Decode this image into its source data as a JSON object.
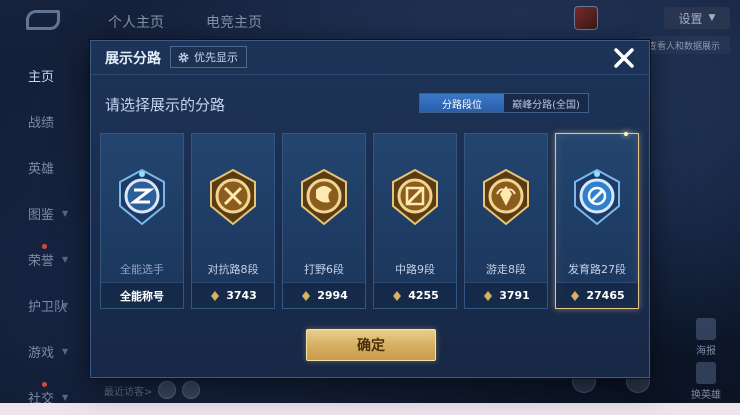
{
  "background": {
    "top_tabs": [
      "个人主页",
      "电竞主页"
    ],
    "settings_label": "设置",
    "lore_label": "查看人和数据展示",
    "side_nav": [
      {
        "label": "主页",
        "active": true,
        "chevron": false,
        "dot": false
      },
      {
        "label": "战绩",
        "active": false,
        "chevron": false,
        "dot": false
      },
      {
        "label": "英雄",
        "active": false,
        "chevron": false,
        "dot": false
      },
      {
        "label": "图鉴",
        "active": false,
        "chevron": true,
        "dot": false
      },
      {
        "label": "荣誉",
        "active": false,
        "chevron": true,
        "dot": true
      },
      {
        "label": "护卫队",
        "active": false,
        "chevron": true,
        "dot": false
      },
      {
        "label": "游戏",
        "active": false,
        "chevron": true,
        "dot": false
      },
      {
        "label": "社交",
        "active": false,
        "chevron": true,
        "dot": true
      }
    ],
    "right_actions": [
      "海报",
      "换英雄"
    ],
    "recent_label": "最近访客>"
  },
  "modal": {
    "title": "展示分路",
    "priority_label": "优先显示",
    "subtitle": "请选择展示的分路",
    "segments": [
      {
        "label": "分路段位",
        "active": true
      },
      {
        "label": "巅峰分路(全国)",
        "active": false
      }
    ],
    "lanes": [
      {
        "name": "全能选手",
        "footer": "全能称号",
        "points": "",
        "badge": "allround",
        "selected": false
      },
      {
        "name": "对抗路8段",
        "footer": "",
        "points": "3743",
        "badge": "clash",
        "selected": false
      },
      {
        "name": "打野6段",
        "footer": "",
        "points": "2994",
        "badge": "jungle",
        "selected": false
      },
      {
        "name": "中路9段",
        "footer": "",
        "points": "4255",
        "badge": "mid",
        "selected": false
      },
      {
        "name": "游走8段",
        "footer": "",
        "points": "3791",
        "badge": "roam",
        "selected": false
      },
      {
        "name": "发育路27段",
        "footer": "",
        "points": "27465",
        "badge": "farm",
        "selected": true
      }
    ],
    "confirm_label": "确定"
  },
  "colors": {
    "gold": "#d7b062",
    "accent_blue": "#3c78c8",
    "selected_border": "#e2c48a"
  }
}
